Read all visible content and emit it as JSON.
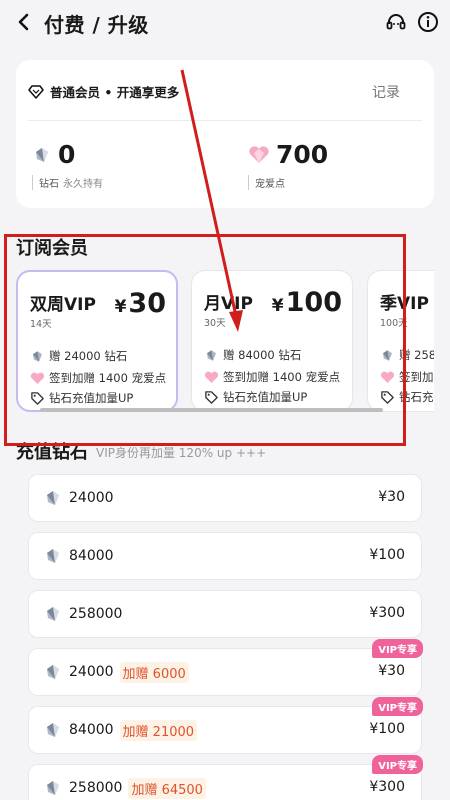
{
  "header": {
    "title": "付费 / 升级",
    "back_icon": "chevron-left-icon",
    "support_icon": "headset-icon",
    "info_icon": "info-circle-icon"
  },
  "member": {
    "status": "普通会员 • 开通享更多",
    "record_label": "记录",
    "diamond_value": "0",
    "diamond_label": "钻石",
    "diamond_sub": "永久持有",
    "love_value": "700",
    "love_label": "宠爱点"
  },
  "subscription": {
    "title": "订阅会员",
    "plans": [
      {
        "name": "双周VIP",
        "days": "14天",
        "currency": "¥",
        "price": "30",
        "perk1": "赠 24000 钻石",
        "perk2": "签到加赠 1400 宠爱点",
        "perk3": "钻石充值加量UP"
      },
      {
        "name": "月VIP",
        "days": "30天",
        "currency": "¥",
        "price": "100",
        "perk1": "赠 84000 钻石",
        "perk2": "签到加赠 1400 宠爱点",
        "perk3": "钻石充值加量UP"
      },
      {
        "name": "季VIP",
        "days": "100天",
        "currency": "",
        "price": "",
        "perk1": "赠 258",
        "perk2": "签到加",
        "perk3": "钻石充"
      }
    ]
  },
  "recharge": {
    "title": "充值钻石",
    "note": "VIP身份再加量 120% up +++",
    "items": [
      {
        "amount": "24000",
        "bonus": "",
        "price": "¥30",
        "badge": ""
      },
      {
        "amount": "84000",
        "bonus": "",
        "price": "¥100",
        "badge": ""
      },
      {
        "amount": "258000",
        "bonus": "",
        "price": "¥300",
        "badge": ""
      },
      {
        "amount": "24000",
        "bonus": "加赠 6000",
        "price": "¥30",
        "badge": "VIP专享"
      },
      {
        "amount": "84000",
        "bonus": "加赠 21000",
        "price": "¥100",
        "badge": "VIP专享"
      },
      {
        "amount": "258000",
        "bonus": "加赠 64500",
        "price": "¥300",
        "badge": "VIP专享"
      }
    ]
  },
  "colors": {
    "annotation": "#d21d1d",
    "selected_border": "#c7baf2",
    "vip_badge": "#f0639a",
    "bonus_text": "#e0532a"
  }
}
